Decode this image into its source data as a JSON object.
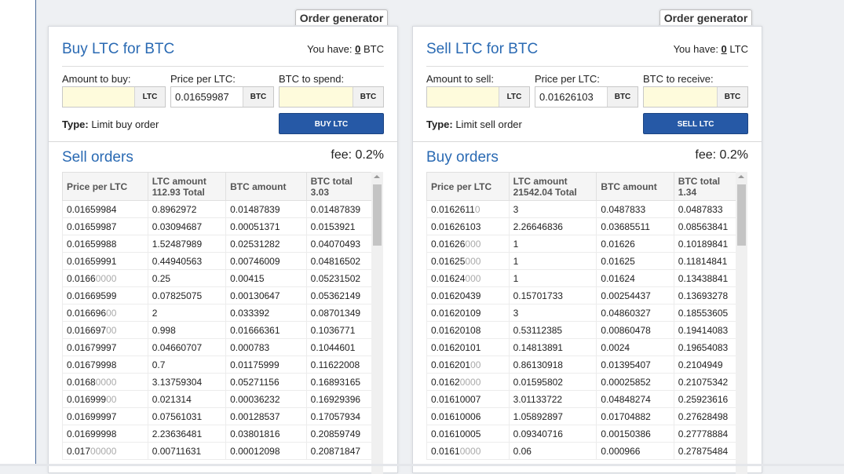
{
  "sell_tab": "Order generator",
  "buy_tab": "Order generator",
  "buy_panel": {
    "title": "Buy LTC for BTC",
    "have_prefix": "You have: ",
    "have_value": "0",
    "have_unit": " BTC",
    "amount_label": "Amount to buy:",
    "amount_value": "",
    "amount_unit": "LTC",
    "price_label": "Price per LTC:",
    "price_value": "0.01659987",
    "price_unit": "BTC",
    "total_label": "BTC to spend:",
    "total_value": "",
    "total_unit": "BTC",
    "type_label": "Type:",
    "type_value": " Limit buy order",
    "action_label": "BUY LTC",
    "orders_title": "Sell orders",
    "fee": "fee: 0.2%",
    "headers": [
      "Price per LTC",
      "LTC amount",
      "112.93 Total",
      "BTC amount",
      "BTC total",
      "3.03"
    ],
    "rows": [
      [
        "0.01659984",
        "",
        "0.8962972",
        "0.01487839",
        "0.01487839"
      ],
      [
        "0.01659987",
        "",
        "0.03094687",
        "0.00051371",
        "0.0153921"
      ],
      [
        "0.01659988",
        "",
        "1.52487989",
        "0.02531282",
        "0.04070493"
      ],
      [
        "0.01659991",
        "",
        "0.44940563",
        "0.00746009",
        "0.04816502"
      ],
      [
        "0.0166",
        "0000",
        "0.25",
        "0.00415",
        "0.05231502"
      ],
      [
        "0.01669599",
        "",
        "0.07825075",
        "0.00130647",
        "0.05362149"
      ],
      [
        "0.016696",
        "00",
        "2",
        "0.033392",
        "0.08701349"
      ],
      [
        "0.016697",
        "00",
        "0.998",
        "0.01666361",
        "0.1036771"
      ],
      [
        "0.01679997",
        "",
        "0.04660707",
        "0.000783",
        "0.1044601"
      ],
      [
        "0.01679998",
        "",
        "0.7",
        "0.01175999",
        "0.11622008"
      ],
      [
        "0.0168",
        "0000",
        "3.13759304",
        "0.05271156",
        "0.16893165"
      ],
      [
        "0.016999",
        "00",
        "0.021314",
        "0.00036232",
        "0.16929396"
      ],
      [
        "0.01699997",
        "",
        "0.07561031",
        "0.00128537",
        "0.17057934"
      ],
      [
        "0.01699998",
        "",
        "2.23636481",
        "0.03801816",
        "0.20859749"
      ],
      [
        "0.017",
        "00000",
        "0.00711631",
        "0.00012098",
        "0.20871847"
      ]
    ]
  },
  "sell_panel": {
    "title": "Sell LTC for BTC",
    "have_prefix": "You have: ",
    "have_value": "0",
    "have_unit": " LTC",
    "amount_label": "Amount to sell:",
    "amount_value": "",
    "amount_unit": "LTC",
    "price_label": "Price per LTC:",
    "price_value": "0.01626103",
    "price_unit": "BTC",
    "total_label": "BTC to receive:",
    "total_value": "",
    "total_unit": "BTC",
    "type_label": "Type:",
    "type_value": " Limit sell order",
    "action_label": "SELL LTC",
    "orders_title": "Buy orders",
    "fee": "fee: 0.2%",
    "headers": [
      "Price per LTC",
      "LTC amount",
      "21542.04 Total",
      "BTC amount",
      "BTC total",
      "1.34"
    ],
    "rows": [
      [
        "0.0162611",
        "0",
        "3",
        "0.0487833",
        "0.0487833"
      ],
      [
        "0.01626103",
        "",
        "2.26646836",
        "0.03685511",
        "0.08563841"
      ],
      [
        "0.01626",
        "000",
        "1",
        "0.01626",
        "0.10189841"
      ],
      [
        "0.01625",
        "000",
        "1",
        "0.01625",
        "0.11814841"
      ],
      [
        "0.01624",
        "000",
        "1",
        "0.01624",
        "0.13438841"
      ],
      [
        "0.01620439",
        "",
        "0.15701733",
        "0.00254437",
        "0.13693278"
      ],
      [
        "0.01620109",
        "",
        "3",
        "0.04860327",
        "0.18553605"
      ],
      [
        "0.01620108",
        "",
        "0.53112385",
        "0.00860478",
        "0.19414083"
      ],
      [
        "0.01620101",
        "",
        "0.14813891",
        "0.0024",
        "0.19654083"
      ],
      [
        "0.016201",
        "00",
        "0.86130918",
        "0.01395407",
        "0.2104949"
      ],
      [
        "0.0162",
        "0000",
        "0.01595802",
        "0.00025852",
        "0.21075342"
      ],
      [
        "0.01610007",
        "",
        "3.01133722",
        "0.04848274",
        "0.25923616"
      ],
      [
        "0.01610006",
        "",
        "1.05892897",
        "0.01704882",
        "0.27628498"
      ],
      [
        "0.01610005",
        "",
        "0.09340716",
        "0.00150386",
        "0.27778884"
      ],
      [
        "0.0161",
        "0000",
        "0.06",
        "0.000966",
        "0.27875484"
      ]
    ]
  }
}
